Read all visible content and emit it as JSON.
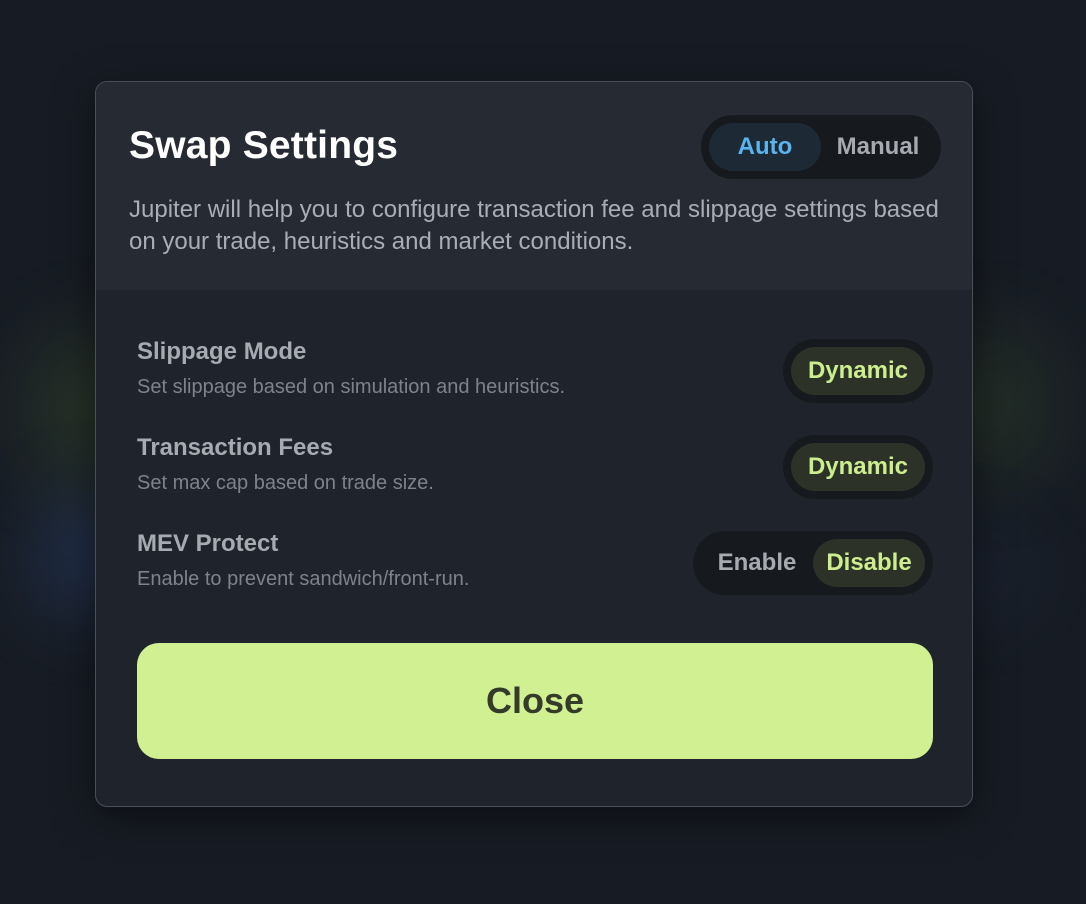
{
  "modal": {
    "title": "Swap Settings",
    "mode_toggle": {
      "options": [
        "Auto",
        "Manual"
      ],
      "selected": "Auto"
    },
    "description": "Jupiter will help you to configure transaction fee and slippage settings based on your trade, heuristics and market conditions."
  },
  "settings": [
    {
      "label": "Slippage Mode",
      "description": "Set slippage based on simulation and heuristics.",
      "options": [
        "Dynamic"
      ],
      "selected": "Dynamic"
    },
    {
      "label": "Transaction Fees",
      "description": "Set max cap based on trade size.",
      "options": [
        "Dynamic"
      ],
      "selected": "Dynamic"
    },
    {
      "label": "MEV Protect",
      "description": "Enable to prevent sandwich/front-run.",
      "options": [
        "Enable",
        "Disable"
      ],
      "selected": "Disable"
    }
  ],
  "close_label": "Close",
  "colors": {
    "accent_lime": "#d0f091",
    "active_text_lime": "#cdee8e",
    "active_text_blue": "#5bb3ee",
    "modal_bg": "#1f242c",
    "page_bg": "#171c24"
  }
}
